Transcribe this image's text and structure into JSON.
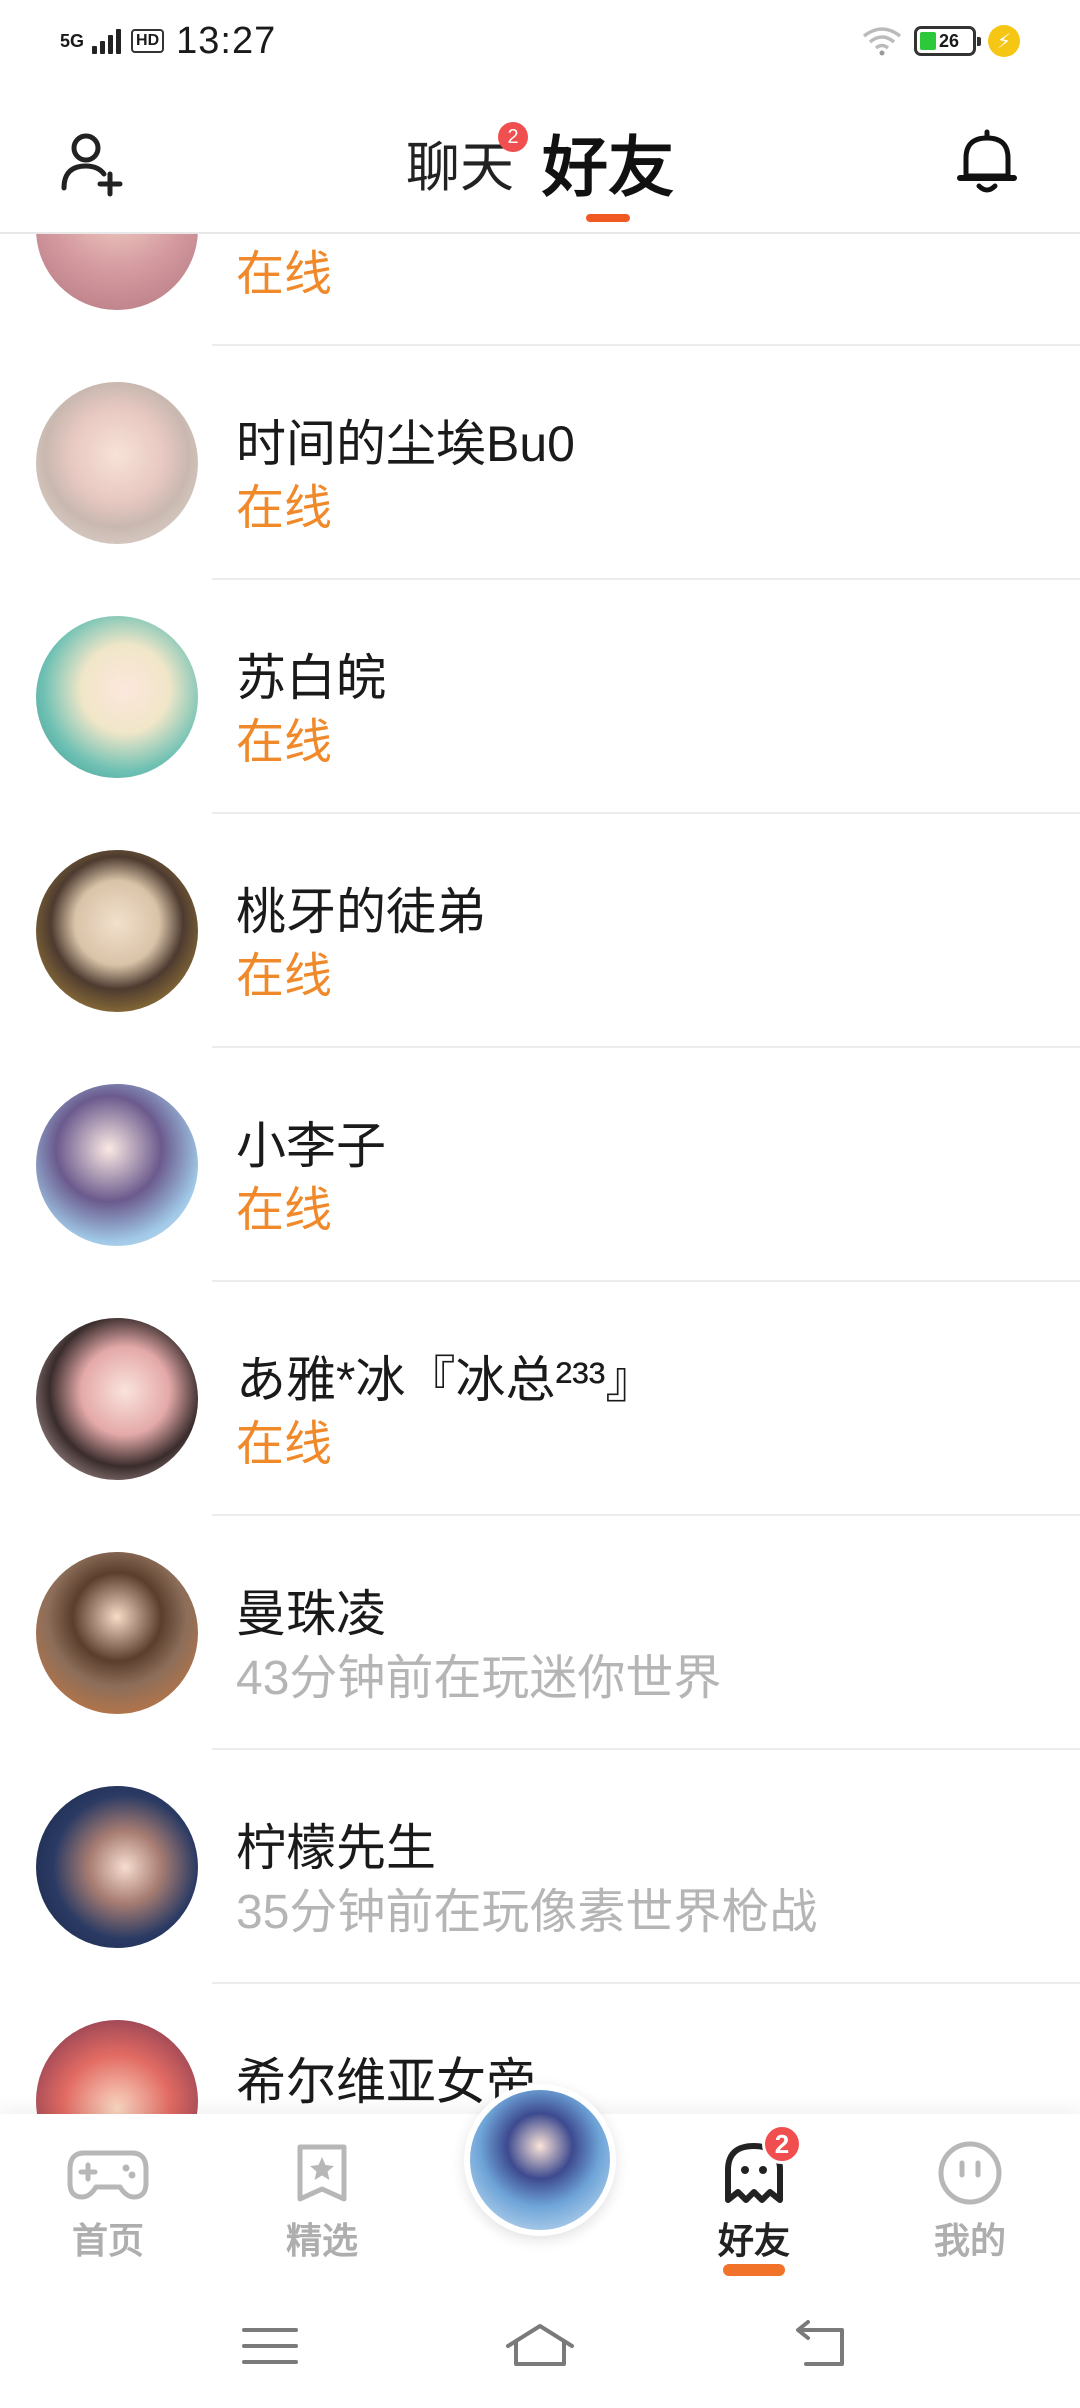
{
  "status_bar": {
    "network": "5G",
    "hd": "HD",
    "time": "13:27",
    "battery": "26",
    "battery_color": "#2ec93a",
    "charging_icon": "lightning-icon"
  },
  "header": {
    "tabs": [
      {
        "label": "聊天",
        "badge": "2",
        "active": false
      },
      {
        "label": "好友",
        "active": true
      }
    ],
    "left_icon": "add-friend-icon",
    "right_icon": "bell-icon",
    "accent_color": "#f05a22"
  },
  "friends": [
    {
      "name": "",
      "status": "在线",
      "online": true
    },
    {
      "name": "时间的尘埃Bu0",
      "status": "在线",
      "online": true
    },
    {
      "name": "苏白皖",
      "status": "在线",
      "online": true
    },
    {
      "name": "桃牙的徒弟",
      "status": "在线",
      "online": true
    },
    {
      "name": "小李子",
      "status": "在线",
      "online": true
    },
    {
      "name": "あ雅*冰『冰总²³³』",
      "status": "在线",
      "online": true
    },
    {
      "name": "曼珠凌",
      "status": "43分钟前在玩迷你世界",
      "online": false
    },
    {
      "name": "柠檬先生",
      "status": "35分钟前在玩像素世界枪战",
      "online": false
    },
    {
      "name": "希尔维亚女帝",
      "status": "",
      "online": false
    }
  ],
  "colors": {
    "online": "#f0892a",
    "offline": "#b5b5b5",
    "badge": "#f14f4f"
  },
  "bottom_nav": {
    "items": [
      {
        "label": "首页",
        "icon": "gamepad-icon"
      },
      {
        "label": "精选",
        "icon": "star-card-icon"
      },
      {
        "label": "好友",
        "icon": "ghost-icon",
        "badge": "2",
        "active": true
      },
      {
        "label": "我的",
        "icon": "smiley-icon"
      }
    ],
    "center": "center-avatar"
  },
  "system_nav": {
    "items": [
      "menu-icon",
      "home-icon",
      "back-icon"
    ]
  }
}
